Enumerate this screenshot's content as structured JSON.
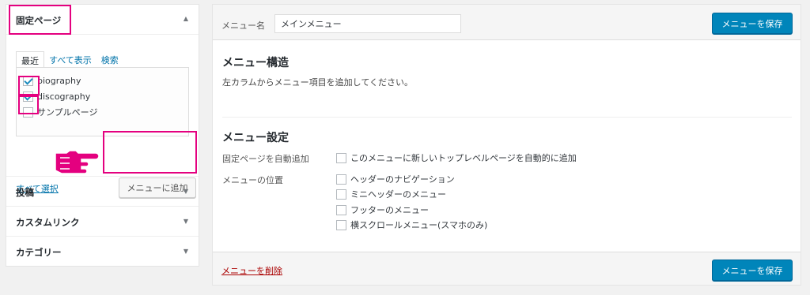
{
  "left": {
    "pages": {
      "title": "固定ページ",
      "tabs": [
        "最近",
        "すべて表示",
        "検索"
      ],
      "items": [
        {
          "label": "biography",
          "checked": true
        },
        {
          "label": "discography",
          "checked": true
        },
        {
          "label": "サンプルページ",
          "checked": false
        }
      ],
      "select_all": "すべて選択",
      "add_button": "メニューに追加"
    },
    "sections": [
      "投稿",
      "カスタムリンク",
      "カテゴリー"
    ]
  },
  "right": {
    "menu_name_label": "メニュー名",
    "menu_name_value": "メインメニュー",
    "save_button": "メニューを保存",
    "structure_title": "メニュー構造",
    "structure_desc": "左カラムからメニュー項目を追加してください。",
    "settings_title": "メニュー設定",
    "auto_add_label": "固定ページを自動追加",
    "auto_add_option": "このメニューに新しいトップレベルページを自動的に追加",
    "location_label": "メニューの位置",
    "locations": [
      "ヘッダーのナビゲーション",
      "ミニヘッダーのメニュー",
      "フッターのメニュー",
      "横スクロールメニュー(スマホのみ)"
    ],
    "delete_link": "メニューを削除"
  },
  "colors": {
    "accent": "#0085ba",
    "highlight": "#e4007f",
    "link": "#0073aa",
    "delete": "#aa0000"
  },
  "icons": {
    "collapse": "triangle-up-icon",
    "expand": "triangle-down-icon",
    "pointer": "pointing-hand-icon",
    "check": "checkmark-icon"
  }
}
